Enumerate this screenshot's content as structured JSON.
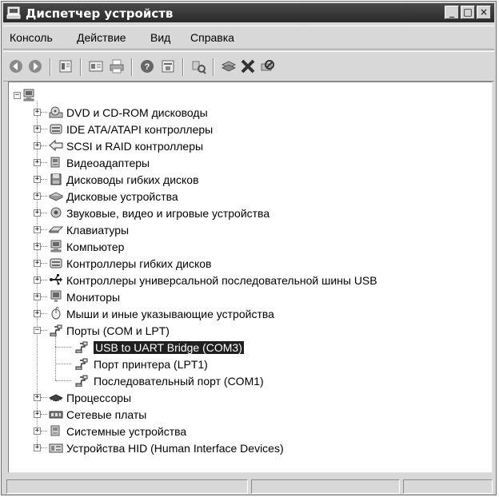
{
  "window": {
    "title": "Диспетчер устройств",
    "controls": [
      "_",
      "□",
      "×"
    ]
  },
  "menu": [
    "Консоль",
    "Действие",
    "Вид",
    "Справка"
  ],
  "toolbar": [
    "back-icon",
    "forward-icon",
    "properties-icon",
    "view-icon",
    "print-icon",
    "help-icon",
    "export-icon",
    "scan-icon",
    "update-driver-icon",
    "uninstall-icon",
    "disable-icon"
  ],
  "tree": {
    "root_icon": "computer-icon",
    "categories": [
      {
        "label": "DVD и CD-ROM дисководы",
        "icon": "cdrom-icon",
        "expanded": false
      },
      {
        "label": "IDE ATA/ATAPI контроллеры",
        "icon": "ide-controller-icon",
        "expanded": false
      },
      {
        "label": "SCSI и RAID контроллеры",
        "icon": "scsi-icon",
        "expanded": false
      },
      {
        "label": "Видеоадаптеры",
        "icon": "display-adapter-icon",
        "expanded": false
      },
      {
        "label": "Дисководы гибких дисков",
        "icon": "floppy-drive-icon",
        "expanded": false
      },
      {
        "label": "Дисковые устройства",
        "icon": "disk-drive-icon",
        "expanded": false
      },
      {
        "label": "Звуковые, видео и игровые устройства",
        "icon": "sound-icon",
        "expanded": false
      },
      {
        "label": "Клавиатуры",
        "icon": "keyboard-icon",
        "expanded": false
      },
      {
        "label": "Компьютер",
        "icon": "computer-icon",
        "expanded": false
      },
      {
        "label": "Контроллеры гибких дисков",
        "icon": "floppy-controller-icon",
        "expanded": false
      },
      {
        "label": "Контроллеры универсальной последовательной шины USB",
        "icon": "usb-icon",
        "expanded": false
      },
      {
        "label": "Мониторы",
        "icon": "monitor-icon",
        "expanded": false
      },
      {
        "label": "Мыши и иные указывающие устройства",
        "icon": "mouse-icon",
        "expanded": false
      },
      {
        "label": "Порты (COM и LPT)",
        "icon": "port-icon",
        "expanded": true,
        "children": [
          {
            "label": "USB to UART Bridge (COM3)",
            "icon": "port-icon",
            "selected": true
          },
          {
            "label": "Порт принтера (LPT1)",
            "icon": "port-icon",
            "selected": false
          },
          {
            "label": "Последовательный порт (COM1)",
            "icon": "port-icon",
            "selected": false
          }
        ]
      },
      {
        "label": "Процессоры",
        "icon": "processor-icon",
        "expanded": false
      },
      {
        "label": "Сетевые платы",
        "icon": "network-card-icon",
        "expanded": false
      },
      {
        "label": "Системные устройства",
        "icon": "system-device-icon",
        "expanded": false
      },
      {
        "label": "Устройства HID (Human Interface Devices)",
        "icon": "hid-icon",
        "expanded": false
      }
    ]
  },
  "status": [
    "",
    "",
    ""
  ]
}
